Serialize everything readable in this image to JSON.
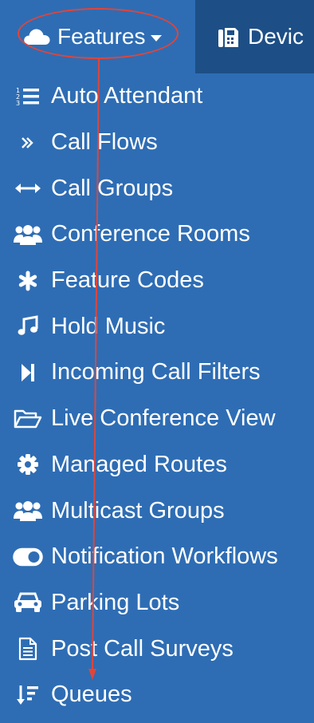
{
  "nav": {
    "features_label": "Features",
    "devices_label": "Devic"
  },
  "menu": {
    "items": [
      {
        "label": "Auto Attendant",
        "icon": "list-ol-icon"
      },
      {
        "label": "Call Flows",
        "icon": "angle-double-right-icon"
      },
      {
        "label": "Call Groups",
        "icon": "arrows-h-icon"
      },
      {
        "label": "Conference Rooms",
        "icon": "users-icon"
      },
      {
        "label": "Feature Codes",
        "icon": "asterisk-icon"
      },
      {
        "label": "Hold Music",
        "icon": "music-icon"
      },
      {
        "label": "Incoming Call Filters",
        "icon": "step-forward-icon"
      },
      {
        "label": "Live Conference View",
        "icon": "folder-open-icon"
      },
      {
        "label": "Managed Routes",
        "icon": "gear-icon"
      },
      {
        "label": "Multicast Groups",
        "icon": "users-icon"
      },
      {
        "label": "Notification Workflows",
        "icon": "toggle-on-icon"
      },
      {
        "label": "Parking Lots",
        "icon": "car-icon"
      },
      {
        "label": "Post Call Surveys",
        "icon": "file-text-icon"
      },
      {
        "label": "Queues",
        "icon": "sort-amount-down-icon"
      }
    ]
  },
  "colors": {
    "background": "#2e6db4",
    "devices_tab": "#1d4f86",
    "annotation": "#e0453a"
  }
}
